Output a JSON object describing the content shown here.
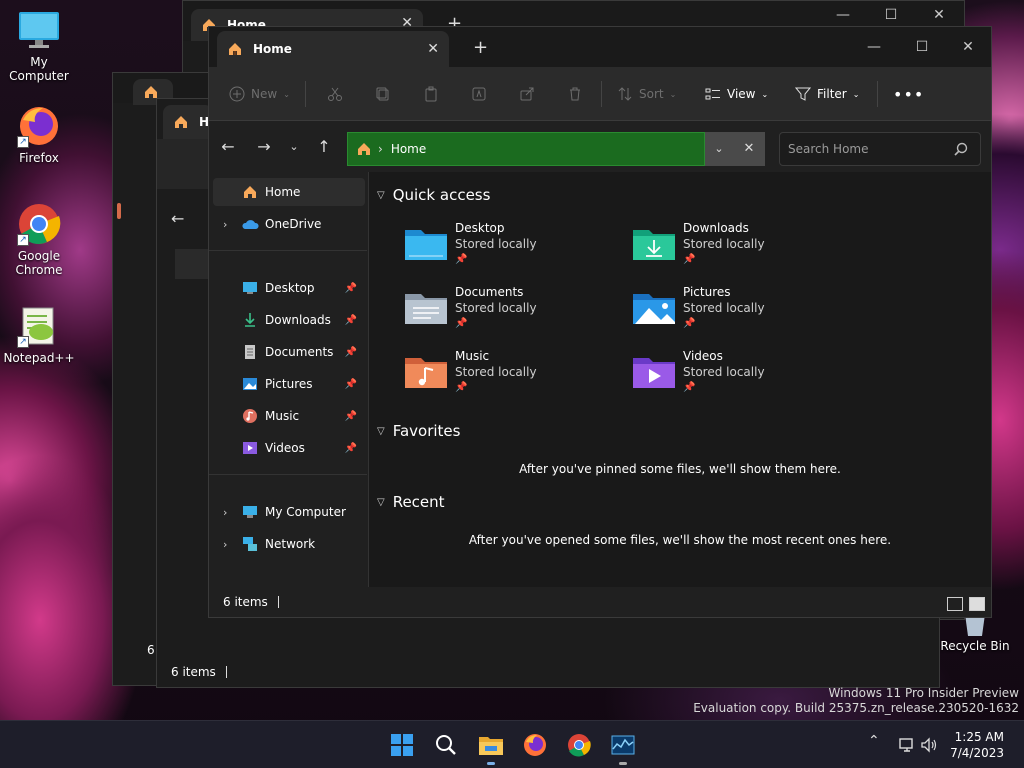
{
  "desktop": {
    "icons": [
      {
        "label": "My Computer"
      },
      {
        "label": "Firefox"
      },
      {
        "label": "Google Chrome"
      },
      {
        "label": "Notepad++"
      },
      {
        "label": "Recycle Bin"
      }
    ],
    "watermark_line1": "Windows 11 Pro Insider Preview",
    "watermark_line2": "Evaluation copy. Build 25375.zn_release.230520-1632"
  },
  "back_windows": {
    "tab_title": "Home",
    "tab_title_short": "H",
    "status_items": "6 items",
    "status_items_short": "6 i"
  },
  "explorer": {
    "tab_title": "Home",
    "toolbar": {
      "new_label": "New",
      "sort_label": "Sort",
      "view_label": "View",
      "filter_label": "Filter"
    },
    "address": {
      "path": "Home"
    },
    "search": {
      "placeholder": "Search Home"
    },
    "sidebar": {
      "home": "Home",
      "onedrive": "OneDrive",
      "quick": [
        "Desktop",
        "Downloads",
        "Documents",
        "Pictures",
        "Music",
        "Videos"
      ],
      "my_computer": "My Computer",
      "network": "Network"
    },
    "content": {
      "quick_access_title": "Quick access",
      "items": [
        {
          "name": "Desktop",
          "sub": "Stored locally"
        },
        {
          "name": "Downloads",
          "sub": "Stored locally"
        },
        {
          "name": "Documents",
          "sub": "Stored locally"
        },
        {
          "name": "Pictures",
          "sub": "Stored locally"
        },
        {
          "name": "Music",
          "sub": "Stored locally"
        },
        {
          "name": "Videos",
          "sub": "Stored locally"
        }
      ],
      "favorites_title": "Favorites",
      "favorites_empty": "After you've pinned some files, we'll show them here.",
      "recent_title": "Recent",
      "recent_empty": "After you've opened some files, we'll show the most recent ones here."
    },
    "status": {
      "items": "6 items"
    }
  },
  "taskbar": {
    "time": "1:25 AM",
    "date": "7/4/2023"
  },
  "colors": {
    "address_bg": "#1b6b1f",
    "accent_blue": "#4cc2ff",
    "folder_yellow": "#f8c45a"
  },
  "icons": [
    "my-computer-icon",
    "firefox-icon",
    "chrome-icon",
    "notepadpp-icon",
    "recycle-bin-icon",
    "home-icon",
    "onedrive-icon",
    "pin-icon",
    "search-icon",
    "start-icon",
    "file-explorer-icon",
    "task-manager-icon"
  ]
}
